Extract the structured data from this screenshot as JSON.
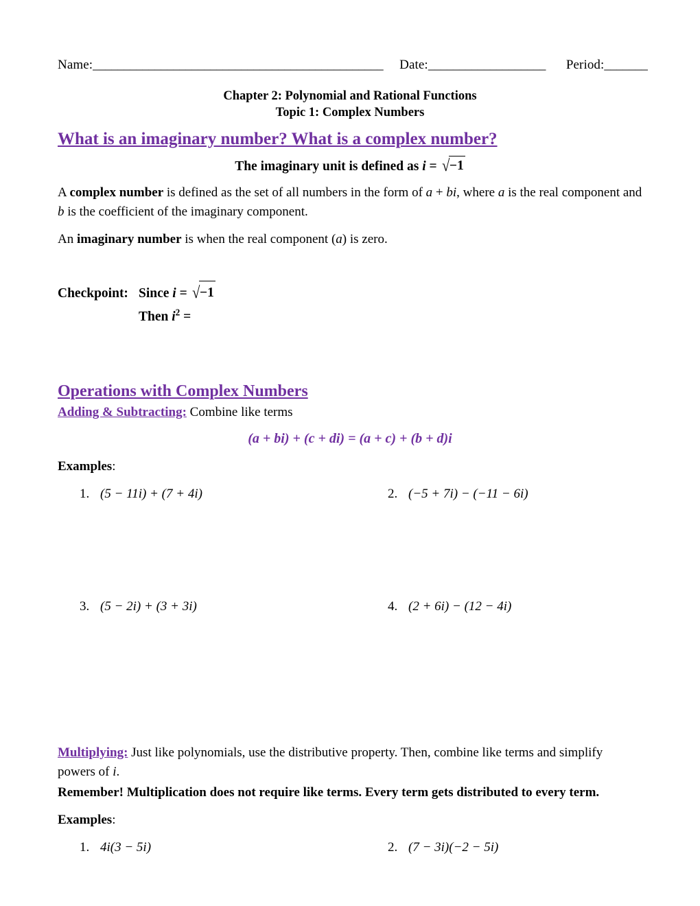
{
  "header": {
    "name_label": "Name:",
    "name_blank": "_______________________________________________",
    "date_label": "Date:",
    "date_blank": "___________________",
    "period_label": "Period:",
    "period_blank": "_______",
    "chapter_line": "Chapter 2: Polynomial and Rational Functions",
    "topic_line": "Topic 1: Complex Numbers"
  },
  "section1": {
    "heading": "What is an imaginary number? What is a complex number?",
    "unit_definition_prefix": "The imaginary unit is defined as ",
    "unit_definition_var": "i",
    "unit_definition_equals": " = ",
    "radical_sign": "√",
    "radical_body": "−1",
    "complex_p1_a": "A ",
    "complex_p1_bold": "complex number",
    "complex_p1_b": " is defined as the set of all numbers in the form of ",
    "complex_p1_form_a": "a",
    "complex_p1_plus": " + ",
    "complex_p1_form_bi": "bi",
    "complex_p1_c": ", where ",
    "complex_p1_var_a": "a",
    "complex_p1_d": " is the real component and ",
    "complex_p1_var_b": "b",
    "complex_p1_e": "  is the coefficient of the imaginary component.",
    "imaginary_p_a": "An ",
    "imaginary_p_bold": "imaginary number",
    "imaginary_p_b": " is when the real component (",
    "imaginary_p_var": "a",
    "imaginary_p_c": ") is zero."
  },
  "checkpoint": {
    "label": "Checkpoint:",
    "since_text": "Since ",
    "since_var": "i",
    "since_equals": " = ",
    "radical_sign": "√",
    "radical_body": "−1",
    "then_text": "Then ",
    "then_var": "i",
    "then_exp": "2",
    "then_equals": " ="
  },
  "section2": {
    "heading": "Operations with Complex Numbers",
    "adding_label": "Adding & Subtracting:",
    "adding_desc": " Combine like terms",
    "adding_formula": "(a + bi) + (c + di) = (a + c) + (b + d)i",
    "examples_label": "Examples",
    "examples_colon": ":",
    "problems": [
      {
        "num": "1.",
        "text": "(5 − 11i) + (7 + 4i)"
      },
      {
        "num": "2.",
        "text": "(−5 + 7i) − (−11 − 6i)"
      },
      {
        "num": "3.",
        "text": "(5 − 2i) + (3 + 3i)"
      },
      {
        "num": "4.",
        "text": "(2 + 6i) − (12 − 4i)"
      }
    ]
  },
  "section3": {
    "multiplying_label": "Multiplying:",
    "multiplying_desc_a": " Just like polynomials, use the distributive property. Then, combine like terms and simplify powers of ",
    "multiplying_desc_var": "i",
    "multiplying_desc_b": ".",
    "remember": "Remember! Multiplication does not require like terms. Every term gets distributed to every term.",
    "examples_label": "Examples",
    "examples_colon": ":",
    "problems": [
      {
        "num": "1.",
        "text": "4i(3 − 5i)"
      },
      {
        "num": "2.",
        "text": "(7 − 3i)(−2 − 5i)"
      }
    ]
  },
  "theme": {
    "purple": "#7030A0",
    "text": "#000000",
    "background": "#FFFFFF"
  }
}
